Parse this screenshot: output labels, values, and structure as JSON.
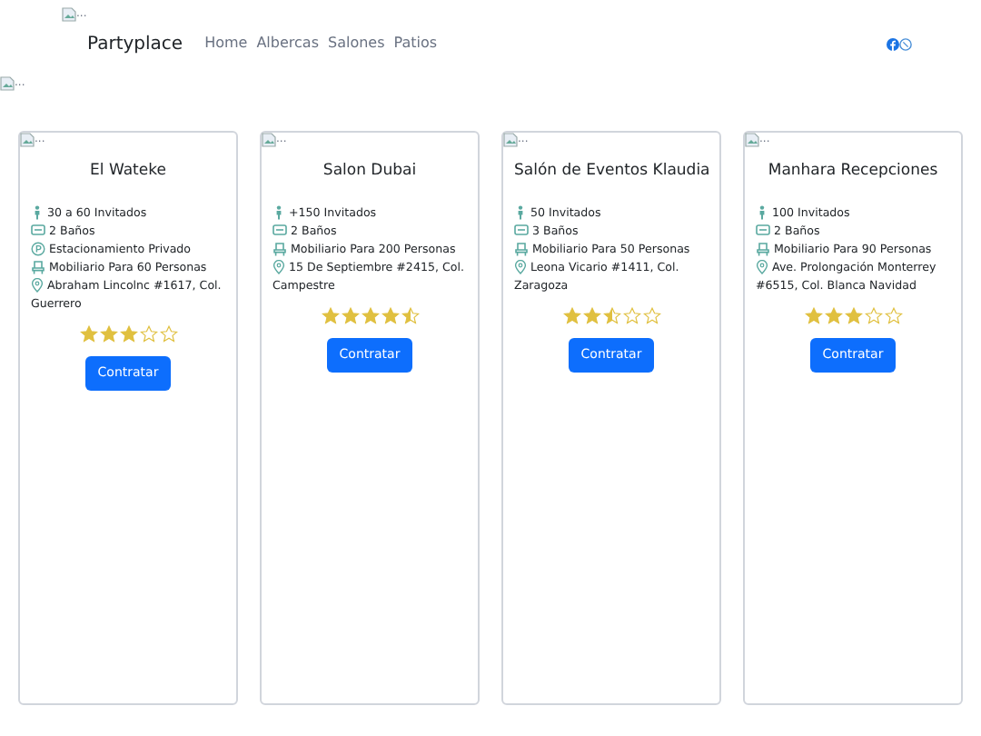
{
  "header_image": {
    "alt": "..."
  },
  "navbar": {
    "brand": "Partyplace",
    "links": [
      {
        "label": "Home"
      },
      {
        "label": "Albercas"
      },
      {
        "label": "Salones"
      },
      {
        "label": "Patios"
      }
    ]
  },
  "banner_image": {
    "alt": "..."
  },
  "cards": [
    {
      "image_alt": "...",
      "title": "El Wateke",
      "features": [
        {
          "kind": "guests",
          "text": "30 a 60 Invitados"
        },
        {
          "kind": "bath",
          "text": "2 Baños"
        },
        {
          "kind": "parking",
          "text": "Estacionamiento Privado"
        },
        {
          "kind": "furniture",
          "text": "Mobiliario Para 60 Personas"
        },
        {
          "kind": "location",
          "text": "Abraham Lincolnc #1617, Col. Guerrero"
        }
      ],
      "stars": 3,
      "button": "Contratar"
    },
    {
      "image_alt": "...",
      "title": "Salon Dubai",
      "features": [
        {
          "kind": "guests",
          "text": "+150 Invitados"
        },
        {
          "kind": "bath",
          "text": "2 Baños"
        },
        {
          "kind": "furniture",
          "text": "Mobiliario Para 200 Personas"
        },
        {
          "kind": "location",
          "text": "15 De Septiembre #2415, Col. Campestre"
        }
      ],
      "stars": 4.5,
      "button": "Contratar"
    },
    {
      "image_alt": "...",
      "title": "Salón de Eventos Klaudia",
      "features": [
        {
          "kind": "guests",
          "text": "50 Invitados"
        },
        {
          "kind": "bath",
          "text": "3 Baños"
        },
        {
          "kind": "furniture",
          "text": "Mobiliario Para 50 Personas"
        },
        {
          "kind": "location",
          "text": "Leona Vicario #1411, Col. Zaragoza"
        }
      ],
      "stars": 2.5,
      "button": "Contratar"
    },
    {
      "image_alt": "...",
      "title": "Manhara Recepciones",
      "features": [
        {
          "kind": "guests",
          "text": "100 Invitados"
        },
        {
          "kind": "bath",
          "text": "2 Baños"
        },
        {
          "kind": "furniture",
          "text": "Mobiliario Para 90 Personas"
        },
        {
          "kind": "location",
          "text": "Ave. Prolongación Monterrey #6515, Col. Blanca Navidad"
        }
      ],
      "stars": 3,
      "button": "Contratar"
    }
  ]
}
